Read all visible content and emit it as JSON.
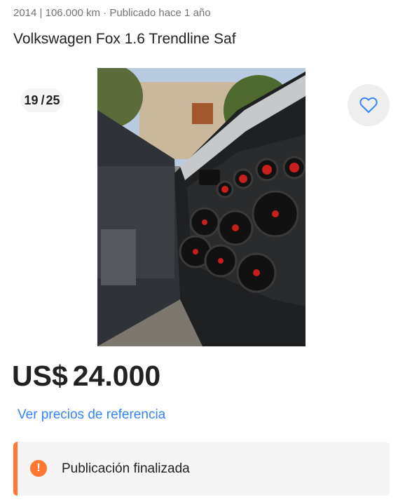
{
  "listing": {
    "subtitle": "2014 | 106.000 km · Publicado hace 1 año",
    "title": "Volkswagen Fox 1.6 Trendline Saf"
  },
  "gallery": {
    "current": "19",
    "total": "25",
    "photo_alt": "Puerta del auto con parlantes instalados",
    "favorite_icon": "heart-outline-icon"
  },
  "price": {
    "currency": "US$",
    "amount": "24.000"
  },
  "links": {
    "reference_prices": "Ver precios de referencia"
  },
  "status": {
    "icon": "alert-icon",
    "text": "Publicación finalizada",
    "accent_color": "#ff7733"
  },
  "colors": {
    "link": "#3483fa",
    "text": "#222222",
    "muted": "#737373"
  }
}
